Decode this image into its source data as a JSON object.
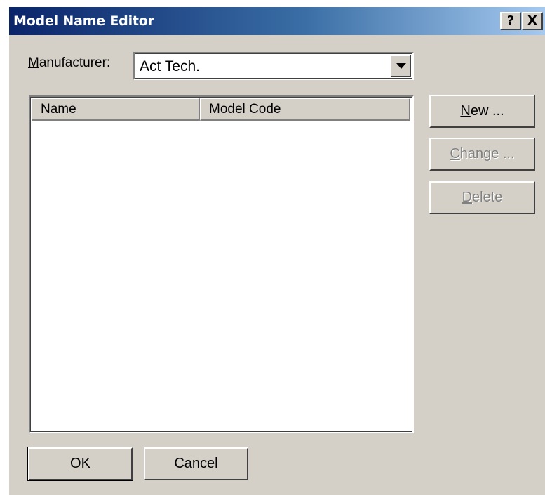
{
  "window": {
    "title": "Model Name Editor",
    "help_button": "?",
    "close_button": "X"
  },
  "manufacturer": {
    "label": "Manufacturer:",
    "selected_value": "Act Tech."
  },
  "list": {
    "columns": [
      "Name",
      "Model Code"
    ],
    "rows": []
  },
  "buttons": {
    "new": "New ...",
    "change": "Change ...",
    "delete": "Delete",
    "ok": "OK",
    "cancel": "Cancel"
  },
  "state": {
    "change_enabled": false,
    "delete_enabled": false
  },
  "colors": {
    "titlebar_start": "#0a246a",
    "titlebar_end": "#a6caf0",
    "dialog_face": "#d4d0c8"
  }
}
